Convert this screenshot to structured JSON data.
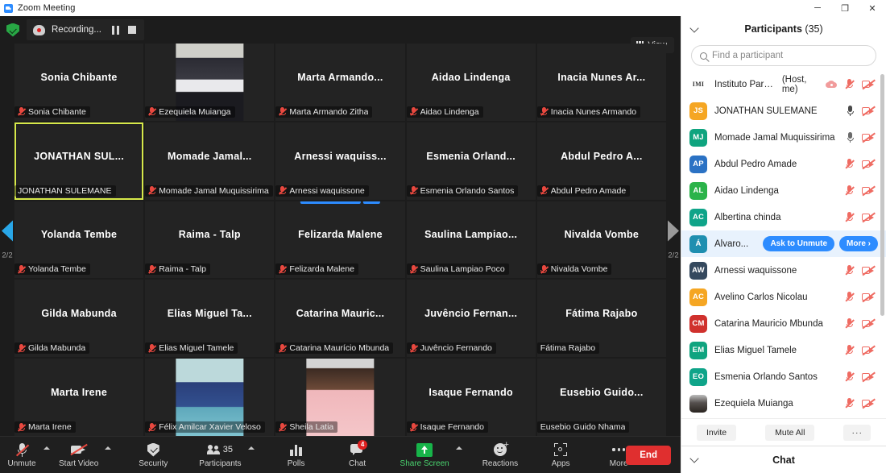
{
  "window": {
    "title": "Zoom Meeting",
    "app_icon": "zoom-logo-icon",
    "minimize": "─",
    "maximize": "❐",
    "close": "✕"
  },
  "recording_bar": {
    "shield_icon": "security-shield-icon",
    "record_icon": "recording-indicator-icon",
    "label": "Recording...",
    "pause_icon": "pause-icon",
    "stop_icon": "stop-icon"
  },
  "view_button": {
    "label": "View",
    "icon": "grid-view-icon"
  },
  "gallery": {
    "page_left": "2/2",
    "page_right": "2/2",
    "left_arrow_icon": "chevron-left-icon",
    "right_arrow_icon": "chevron-right-icon",
    "overlay": {
      "ask_to_unmute": "Ask to Unmute",
      "more": "···"
    },
    "tiles": [
      {
        "big": "Sonia Chibante",
        "foot": "Sonia Chibante",
        "muted": true,
        "video": false,
        "selected": false
      },
      {
        "big": "",
        "foot": "Ezequiela Muianga",
        "muted": true,
        "video": true,
        "selected": false,
        "photo": "woman-dark-jacket"
      },
      {
        "big": "Marta  Armando...",
        "foot": "Marta Armando Zitha",
        "muted": true,
        "video": false,
        "selected": false
      },
      {
        "big": "Aidao Lindenga",
        "foot": "Aidao Lindenga",
        "muted": true,
        "video": false,
        "selected": false
      },
      {
        "big": "Inacia Nunes Ar...",
        "foot": "Inacia Nunes Armando",
        "muted": true,
        "video": false,
        "selected": false
      },
      {
        "big": "JONATHAN SUL...",
        "foot": "JONATHAN SULEMANE",
        "muted": false,
        "video": false,
        "selected": true
      },
      {
        "big": "Momade  Jamal...",
        "foot": "Momade Jamal Muquissirima",
        "muted": true,
        "video": false,
        "selected": false
      },
      {
        "big": "Arnessi  waquiss...",
        "foot": "Arnessi waquissone",
        "muted": true,
        "video": false,
        "selected": false
      },
      {
        "big": "Esmenia  Orland...",
        "foot": "Esmenia Orlando Santos",
        "muted": true,
        "video": false,
        "selected": false
      },
      {
        "big": "Abdul Pedro A...",
        "foot": "Abdul Pedro Amade",
        "muted": true,
        "video": false,
        "selected": false
      },
      {
        "big": "Yolanda Tembe",
        "foot": "Yolanda Tembe",
        "muted": true,
        "video": false,
        "selected": false
      },
      {
        "big": "Raima - Talp",
        "foot": "Raima - Talp",
        "muted": true,
        "video": false,
        "selected": false
      },
      {
        "big": "Felizarda Malene",
        "foot": "Felizarda Malene",
        "muted": true,
        "video": false,
        "selected": false,
        "hover": true
      },
      {
        "big": "Saulina  Lampiao...",
        "foot": "Saulina Lampiao Poco",
        "muted": true,
        "video": false,
        "selected": false
      },
      {
        "big": "Nivalda Vombe",
        "foot": "Nivalda Vombe",
        "muted": true,
        "video": false,
        "selected": false
      },
      {
        "big": "Gilda Mabunda",
        "foot": "Gilda Mabunda",
        "muted": true,
        "video": false,
        "selected": false
      },
      {
        "big": "Elias Miguel Ta...",
        "foot": "Elias Miguel Tamele",
        "muted": true,
        "video": false,
        "selected": false
      },
      {
        "big": "Catarina  Mauric...",
        "foot": "Catarina Maurício Mbunda",
        "muted": true,
        "video": false,
        "selected": false
      },
      {
        "big": "Juvêncio  Fernan...",
        "foot": "Juvêncio Fernando",
        "muted": true,
        "video": false,
        "selected": false
      },
      {
        "big": "Fátima Rajabo",
        "foot": "Fátima Rajabo",
        "muted": false,
        "video": false,
        "selected": false
      },
      {
        "big": "Marta Irene",
        "foot": "Marta Irene",
        "muted": true,
        "video": false,
        "selected": false
      },
      {
        "big": "",
        "foot": "Félix Amilcar Xavier Veloso",
        "muted": true,
        "video": true,
        "selected": false,
        "photo": "man-blue-suit"
      },
      {
        "big": "",
        "foot": "Sheila Latia",
        "muted": true,
        "video": true,
        "selected": false,
        "photo": "woman-pink-top"
      },
      {
        "big": "Isaque Fernando",
        "foot": "Isaque Fernando",
        "muted": true,
        "video": false,
        "selected": false
      },
      {
        "big": "Eusebio  Guido...",
        "foot": "Eusebio Guido Nhama",
        "muted": false,
        "video": false,
        "selected": false
      }
    ]
  },
  "toolbar": {
    "unmute": {
      "label": "Unmute",
      "icon": "microphone-muted-icon",
      "has_caret": true
    },
    "start_video": {
      "label": "Start Video",
      "icon": "camera-off-icon",
      "has_caret": true
    },
    "security": {
      "label": "Security",
      "icon": "shield-icon",
      "has_caret": false
    },
    "participants": {
      "label": "Participants",
      "icon": "people-icon",
      "count": "35",
      "has_caret": true
    },
    "polls": {
      "label": "Polls",
      "icon": "bar-chart-icon",
      "has_caret": false
    },
    "chat": {
      "label": "Chat",
      "icon": "chat-bubble-icon",
      "badge": "4",
      "has_caret": false
    },
    "share_screen": {
      "label": "Share Screen",
      "icon": "share-screen-icon",
      "has_caret": true
    },
    "reactions": {
      "label": "Reactions",
      "icon": "smiley-plus-icon",
      "has_caret": false
    },
    "apps": {
      "label": "Apps",
      "icon": "apps-icon",
      "has_caret": false
    },
    "more": {
      "label": "More",
      "icon": "ellipsis-icon",
      "has_caret": false
    },
    "end": {
      "label": "End"
    }
  },
  "participants_panel": {
    "collapse_icon": "chevron-down-icon",
    "title": "Participants",
    "count": "(35)",
    "search": {
      "placeholder": "Find a participant",
      "icon": "search-icon"
    },
    "rows": [
      {
        "initials": "IMI",
        "color": "#ffffff",
        "name": "Instituto Para D...",
        "tag": "(Host, me)",
        "mic": "muted",
        "video": "off",
        "rec": true,
        "avatar_image": true
      },
      {
        "initials": "JS",
        "color": "#f5a623",
        "name": "JONATHAN SULEMANE",
        "tag": "",
        "mic": "on-dark",
        "video": "off",
        "rec": false
      },
      {
        "initials": "MJ",
        "color": "#0fa47f",
        "name": "Momade Jamal Muquissirima",
        "tag": "",
        "mic": "on",
        "video": "off",
        "rec": false
      },
      {
        "initials": "AP",
        "color": "#2b72c4",
        "name": "Abdul Pedro Amade",
        "tag": "",
        "mic": "muted",
        "video": "off",
        "rec": false
      },
      {
        "initials": "AL",
        "color": "#2bb34a",
        "name": "Aidao Lindenga",
        "tag": "",
        "mic": "muted",
        "video": "off",
        "rec": false
      },
      {
        "initials": "AC",
        "color": "#0fa489",
        "name": "Albertina chinda",
        "tag": "",
        "mic": "muted",
        "video": "off",
        "rec": false
      },
      {
        "initials": "Á",
        "color": "#1f8fb0",
        "name": "Álvaro...",
        "tag": "",
        "mic": "none",
        "video": "none",
        "rec": false,
        "active": true,
        "actions": {
          "ask_to_unmute": "Ask to Unmute",
          "more": "More ›"
        }
      },
      {
        "initials": "AW",
        "color": "#35495e",
        "name": "Arnessi waquissone",
        "tag": "",
        "mic": "muted",
        "video": "off",
        "rec": false
      },
      {
        "initials": "AC",
        "color": "#f5a623",
        "name": "Avelino Carlos Nicolau",
        "tag": "",
        "mic": "muted",
        "video": "off",
        "rec": false
      },
      {
        "initials": "CM",
        "color": "#d0312d",
        "name": "Catarina Mauricio Mbunda",
        "tag": "",
        "mic": "muted",
        "video": "off",
        "rec": false
      },
      {
        "initials": "EM",
        "color": "#0fa47f",
        "name": "Elias Miguel Tamele",
        "tag": "",
        "mic": "muted",
        "video": "off",
        "rec": false
      },
      {
        "initials": "EO",
        "color": "#0fa489",
        "name": "Esmenia Orlando Santos",
        "tag": "",
        "mic": "muted",
        "video": "off",
        "rec": false
      },
      {
        "initials": "",
        "color": "#6b6b6b",
        "name": "Ezequiela Muianga",
        "tag": "",
        "mic": "muted",
        "video": "off",
        "rec": false,
        "avatar_image": true
      }
    ],
    "actions": {
      "invite": "Invite",
      "mute_all": "Mute All",
      "more": "···"
    }
  },
  "chat_section": {
    "title": "Chat",
    "collapse_icon": "chevron-down-icon"
  },
  "colors": {
    "accent_blue": "#2D8CFF",
    "end_red": "#e02f2f",
    "share_green": "#17b449",
    "selected_tile": "#d6e84a",
    "muted_red": "#ef6b62",
    "panel_active": "#e8f2fd"
  }
}
